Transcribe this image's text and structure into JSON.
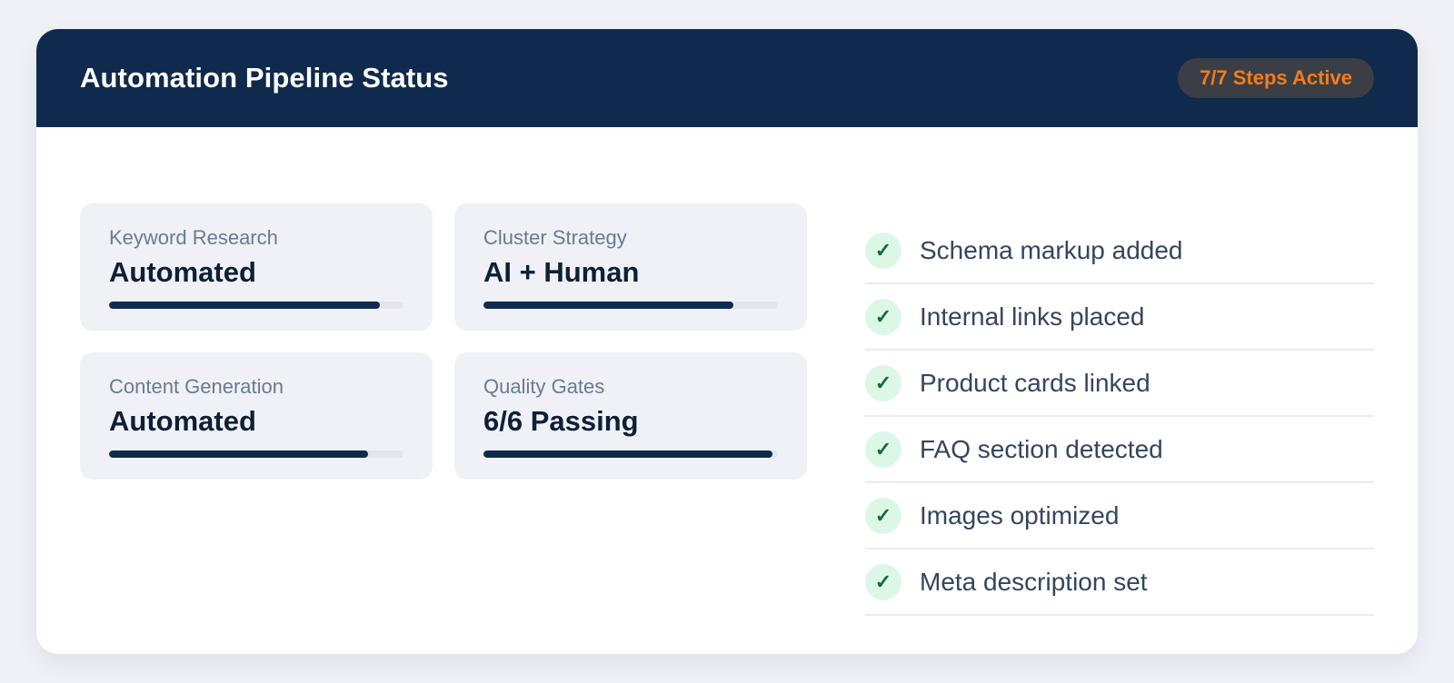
{
  "header": {
    "title": "Automation Pipeline Status",
    "badge": "7/7 Steps Active"
  },
  "stats": [
    {
      "label": "Keyword Research",
      "value": "Automated",
      "progress": 0.92
    },
    {
      "label": "Cluster Strategy",
      "value": "AI + Human",
      "progress": 0.85
    },
    {
      "label": "Content Generation",
      "value": "Automated",
      "progress": 0.88
    },
    {
      "label": "Quality Gates",
      "value": "6/6 Passing",
      "progress": 0.98
    }
  ],
  "checklist": {
    "icon": "checkmark-icon",
    "items": [
      {
        "mark": "✓",
        "text": "Schema markup added"
      },
      {
        "mark": "✓",
        "text": "Internal links placed"
      },
      {
        "mark": "✓",
        "text": "Product cards linked"
      },
      {
        "mark": "✓",
        "text": "FAQ section detected"
      },
      {
        "mark": "✓",
        "text": "Images optimized"
      },
      {
        "mark": "✓",
        "text": "Meta description set"
      }
    ]
  },
  "colors": {
    "header_bg": "#0f2a4c",
    "badge_text": "#f47c1c",
    "badge_bg": "#3b3e45",
    "check_bg": "#dcf7e6",
    "check_mark": "#136b3c",
    "bar_fill": "#0f2a4c"
  }
}
